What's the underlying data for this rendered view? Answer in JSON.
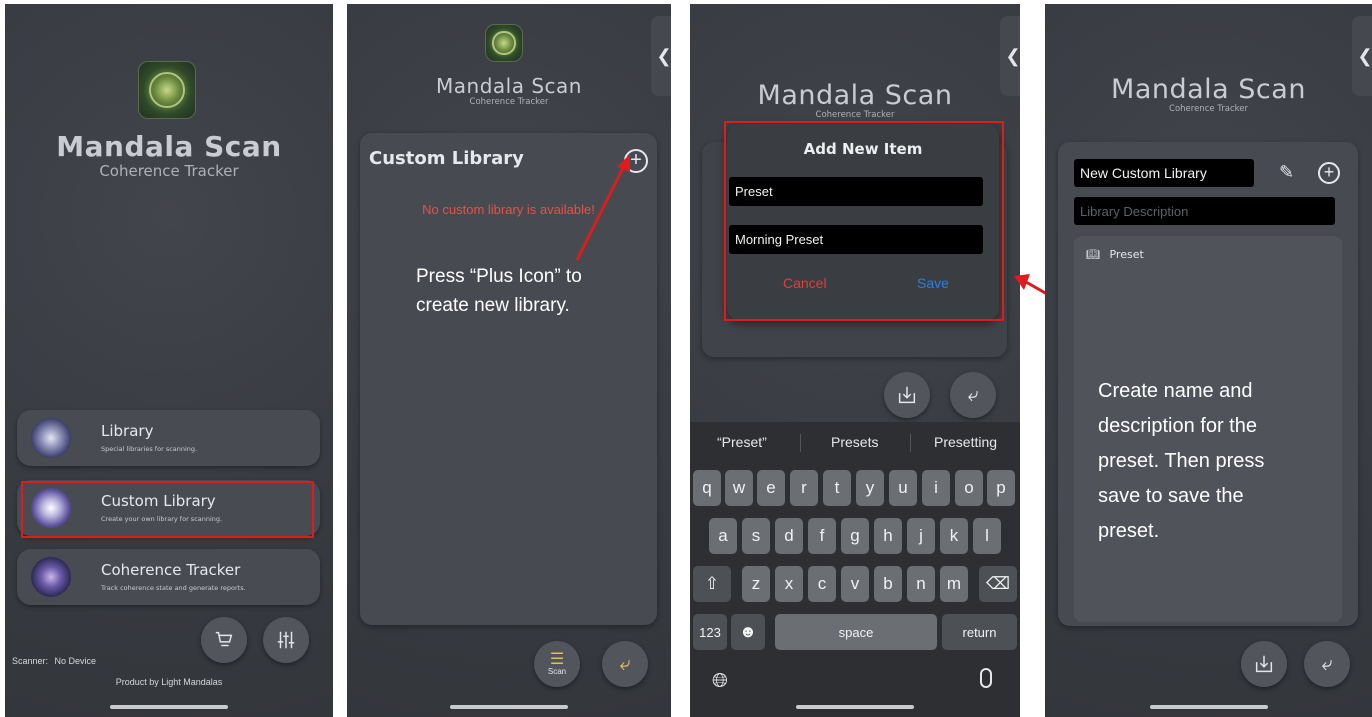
{
  "app": {
    "title": "Mandala Scan",
    "subtitle": "Coherence Tracker"
  },
  "screen1": {
    "menu": [
      {
        "title": "Library",
        "desc": "Special libraries for scanning."
      },
      {
        "title": "Custom Library",
        "desc": "Create your own library for scanning."
      },
      {
        "title": "Coherence Tracker",
        "desc": "Track coherence state and generate reports."
      }
    ],
    "scanner_label": "Scanner:",
    "scanner_value": "No Device",
    "footer": "Product by Light Mandalas"
  },
  "screen2": {
    "header": "Custom Library",
    "empty_message": "No custom library is available!",
    "annotation_line1": "Press “Plus Icon” to",
    "annotation_line2": "create new library.",
    "scan_label": "Scan"
  },
  "screen3": {
    "dialog_title": "Add New Item",
    "name_value": "Preset",
    "desc_value": "Morning Preset",
    "cancel": "Cancel",
    "save": "Save",
    "suggestions": [
      "“Preset”",
      "Presets",
      "Presetting"
    ],
    "keys_row1": [
      "q",
      "w",
      "e",
      "r",
      "t",
      "y",
      "u",
      "i",
      "o",
      "p"
    ],
    "keys_row2": [
      "a",
      "s",
      "d",
      "f",
      "g",
      "h",
      "j",
      "k",
      "l"
    ],
    "keys_row3": [
      "z",
      "x",
      "c",
      "v",
      "b",
      "n",
      "m"
    ],
    "key_123": "123",
    "key_space": "space",
    "key_return": "return"
  },
  "screen4": {
    "library_name": "New Custom Library",
    "desc_placeholder": "Library Description",
    "item": "Preset",
    "annotation": [
      "Create name and",
      "description for the",
      "preset. Then press",
      "save to save the",
      "preset."
    ]
  },
  "colors": {
    "accent_red": "#e01b1b",
    "empty_red": "#e0544a",
    "save_blue": "#2f7fe0",
    "cancel_red": "#d8433a"
  }
}
